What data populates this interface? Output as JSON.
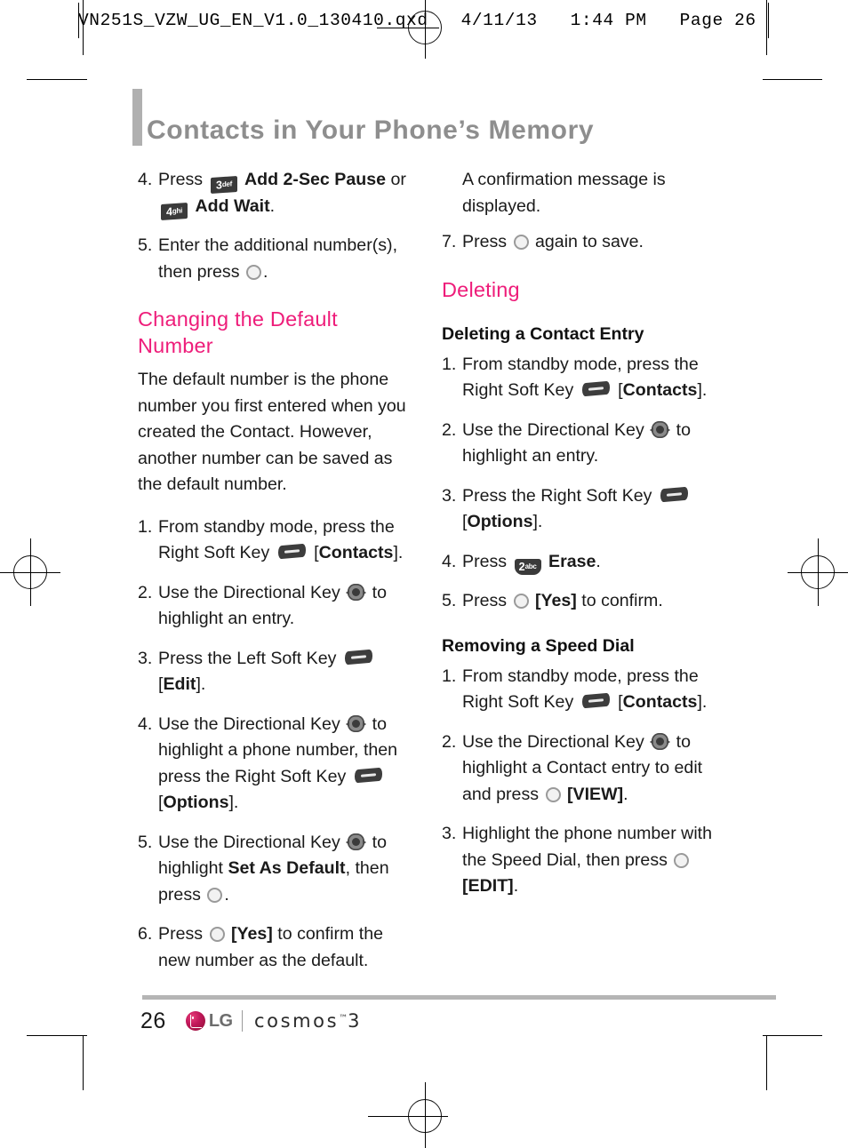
{
  "prepress": {
    "header": "VN251S_VZW_UG_EN_V1.0_130410.qxd   4/11/13   1:44 PM   Page 26"
  },
  "page_title": "Contacts in Your Phone’s Memory",
  "colors": {
    "heading_accent": "#ee1d7a",
    "title_gray": "#8e8e8e",
    "rule_gray": "#b5b5b5",
    "lg_crimson": "#a4123f"
  },
  "left_column": {
    "steps_continued": [
      {
        "num": "4.",
        "prefix": "Press",
        "icon1": "key-3-def",
        "bold1": "Add 2-Sec Pause",
        "mid": "or",
        "icon2": "key-4-ghi",
        "bold2": "Add Wait",
        "suffix": "."
      },
      {
        "num": "5.",
        "text_a": "Enter the additional number(s),",
        "text_b": "then press",
        "icon": "ok-key",
        "suffix": "."
      }
    ],
    "section_heading": "Changing the Default Number",
    "body_paragraph": "The default number is the phone number you first entered when you created the Contact. However, another number can be saved as the default number.",
    "steps": [
      {
        "num": "1.",
        "line1": "From standby mode, press the",
        "line2_pre": "Right Soft Key",
        "icon": "soft-key",
        "line2_post_open": "[",
        "line2_bold": "Contacts",
        "line2_post_close": "]."
      },
      {
        "num": "2.",
        "pre": "Use the Directional Key",
        "icon": "directional-key",
        "post": "to",
        "line2": "highlight an entry."
      },
      {
        "num": "3.",
        "pre": "Press the Left Soft Key",
        "icon": "soft-key",
        "line2_open": "[",
        "line2_bold": "Edit",
        "line2_close": "]."
      },
      {
        "num": "4.",
        "pre": "Use the Directional Key",
        "icon": "directional-key",
        "post": "to",
        "line2": "highlight a phone number, then",
        "line3_pre": "press the Right Soft Key",
        "icon2": "soft-key",
        "line4_open": "[",
        "line4_bold": "Options",
        "line4_close": "]."
      },
      {
        "num": "5.",
        "pre": "Use the Directional Key",
        "icon": "directional-key",
        "post": "to",
        "line2_pre": "highlight",
        "line2_bold": "Set As Default",
        "line2_post": ", then",
        "line3_pre": "press",
        "icon2": "ok-key",
        "line3_post": "."
      },
      {
        "num": "6.",
        "pre": "Press",
        "icon": "ok-key",
        "bold": "[Yes]",
        "post": "to confirm the",
        "line2": "new number as the default."
      }
    ]
  },
  "right_column": {
    "intro": {
      "line1": "A confirmation message is",
      "line2": "displayed."
    },
    "step7": {
      "num": "7.",
      "pre": "Press",
      "icon": "ok-key",
      "post": "again to save."
    },
    "section_heading": "Deleting",
    "subsections": [
      {
        "heading": "Deleting a Contact Entry",
        "steps": [
          {
            "num": "1.",
            "line1": "From standby mode, press the",
            "line2_pre": "Right Soft Key",
            "icon": "soft-key",
            "line2_open": "[",
            "line2_bold": "Contacts",
            "line2_close": "]."
          },
          {
            "num": "2.",
            "pre": "Use the Directional Key",
            "icon": "directional-key",
            "post": "to",
            "line2": "highlight an entry."
          },
          {
            "num": "3.",
            "pre": "Press the Right Soft Key",
            "icon": "soft-key",
            "line2_open": "[",
            "line2_bold": "Options",
            "line2_close": "]."
          },
          {
            "num": "4.",
            "pre": "Press",
            "icon": "key-2-abc",
            "bold": "Erase",
            "post": "."
          },
          {
            "num": "5.",
            "pre": "Press",
            "icon": "ok-key",
            "bold": "[Yes]",
            "post": "to confirm."
          }
        ]
      },
      {
        "heading": "Removing a Speed Dial",
        "steps": [
          {
            "num": "1.",
            "line1": "From standby mode, press the",
            "line2_pre": "Right Soft Key",
            "icon": "soft-key",
            "line2_open": "[",
            "line2_bold": "Contacts",
            "line2_close": "]."
          },
          {
            "num": "2.",
            "pre": "Use the Directional Key",
            "icon": "directional-key",
            "post": "to",
            "line2": "highlight a Contact entry to edit",
            "line3_pre": "and press",
            "icon2": "ok-key",
            "line3_bold": "[VIEW]",
            "line3_post": "."
          },
          {
            "num": "3.",
            "line1": "Highlight the phone number with",
            "line2_pre": "the Speed Dial, then press",
            "icon": "ok-key",
            "line3_bold": "[EDIT]",
            "line3_post": "."
          }
        ]
      }
    ]
  },
  "key_icons": {
    "key_3_def": {
      "digit": "3",
      "letters": "def"
    },
    "key_4_ghi": {
      "digit": "4",
      "letters": "ghi"
    },
    "key_2_abc": {
      "digit": "2",
      "letters": "abc"
    }
  },
  "footer": {
    "page_number": "26",
    "brand": "LG",
    "product": "cosmos",
    "trademark": "™",
    "model": "3"
  }
}
